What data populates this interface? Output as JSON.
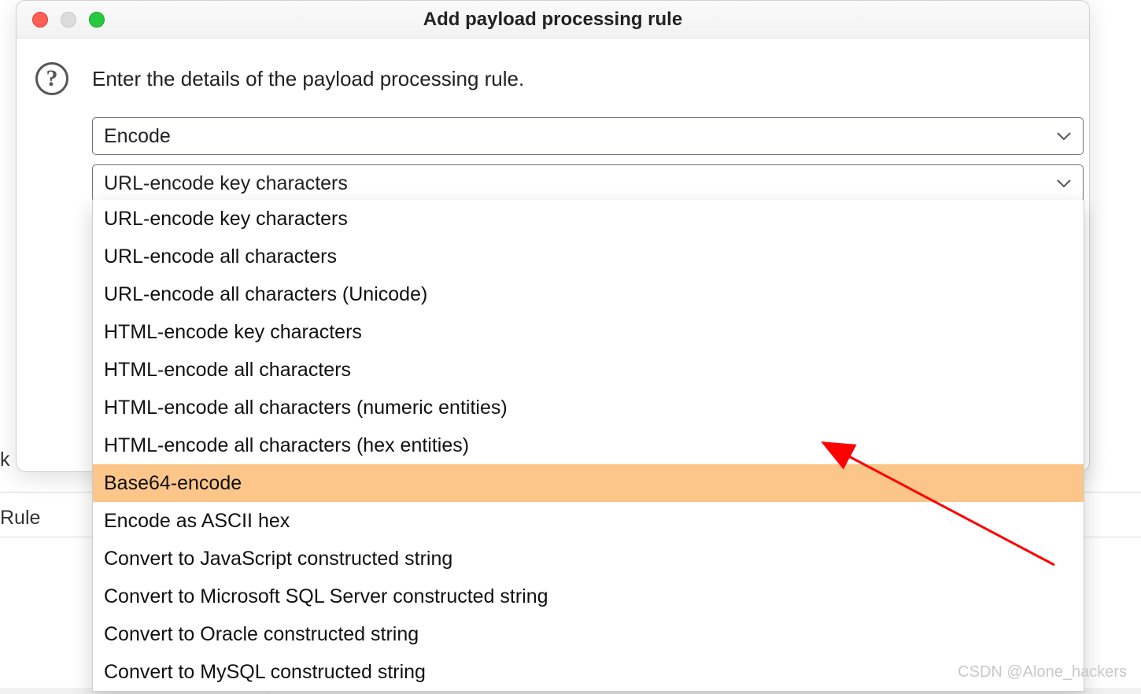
{
  "window": {
    "title": "Add payload processing rule"
  },
  "instruction": "Enter the details of the payload processing rule.",
  "help_icon_glyph": "?",
  "select1": {
    "value": "Encode"
  },
  "select2": {
    "value": "URL-encode key characters"
  },
  "options": [
    "URL-encode key characters",
    "URL-encode all characters",
    "URL-encode all characters (Unicode)",
    "HTML-encode key characters",
    "HTML-encode all characters",
    "HTML-encode all characters (numeric entities)",
    "HTML-encode all characters (hex entities)",
    "Base64-encode",
    "Encode as ASCII hex",
    "Convert to JavaScript constructed string",
    "Convert to Microsoft SQL Server constructed string",
    "Convert to Oracle constructed string",
    "Convert to MySQL constructed string"
  ],
  "highlight_index": 7,
  "background": {
    "rule_label": "Rule",
    "k_char": "k"
  },
  "watermark": "CSDN @Alone_hackers"
}
